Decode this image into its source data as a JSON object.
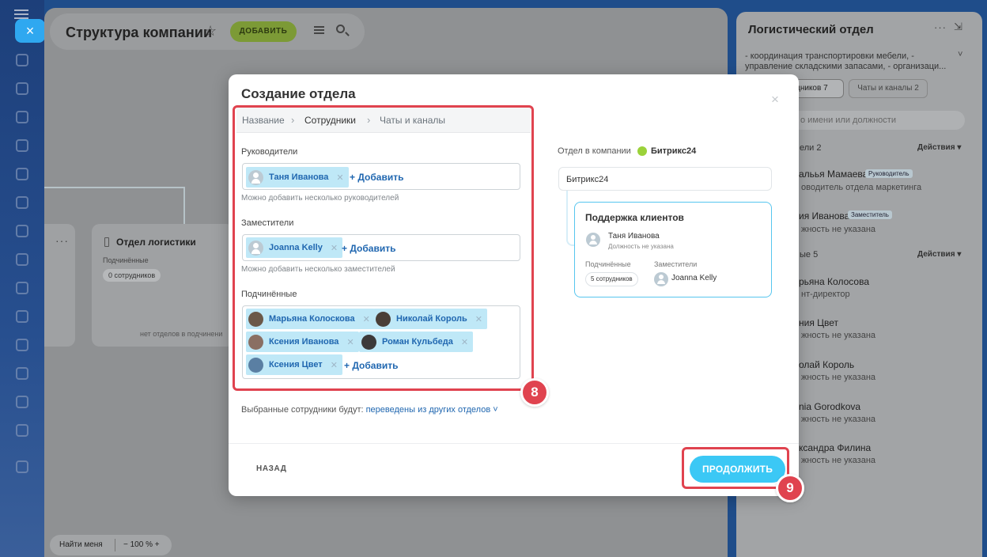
{
  "page": {
    "title": "Структура компании",
    "add_label": "ДОБАВИТЬ",
    "find_me": "Найти меня",
    "zoom_text": "−  100 %  +"
  },
  "org_card": {
    "title": "Отдел логистики",
    "subordinates_label": "Подчинённые",
    "count_badge": "0 сотрудников",
    "no_departments": "нет отделов в подчинени"
  },
  "right_panel": {
    "title": "Логистический отдел",
    "description": "- координация транспортировки мебели, - управление складскими запасами, - организаци...",
    "tab_employees": "дников 7",
    "tab_chats": "Чаты и каналы 2",
    "search_placeholder": "о имени или должности",
    "section_heads": "ели 2",
    "section_employees": "ые 5",
    "actions_label": "Действия ▾",
    "people": [
      {
        "name": "альья Мамаева",
        "badge": "Руководитель",
        "position": "оводитель отдела маркетинга"
      },
      {
        "name": "ия Иванова",
        "badge": "Заместитель",
        "position": "жность не указана"
      },
      {
        "name": "рьяна Колосова",
        "position": "нт-директор"
      },
      {
        "name": "ния Цвет",
        "position": "жность не указана"
      },
      {
        "name": "олай Король",
        "position": "жность не указана"
      },
      {
        "name": "nia Gorodkova",
        "position": "жность не указана"
      },
      {
        "name": "ксандра Филина",
        "position": "жность не указана"
      }
    ]
  },
  "modal": {
    "title": "Создание отдела",
    "close": "×",
    "breadcrumbs": [
      "Название",
      "Сотрудники",
      "Чаты и каналы"
    ],
    "heads_label": "Руководители",
    "heads": [
      "Таня Иванова"
    ],
    "heads_hint": "Можно добавить несколько руководителей",
    "deputies_label": "Заместители",
    "deputies": [
      "Joanna Kelly"
    ],
    "deputies_hint": "Можно добавить несколько заместителей",
    "employees_label": "Подчинённые",
    "employees": [
      "Марьяна Колоскова",
      "Николай Король",
      "Ксения Иванова",
      "Роман Кульбеда",
      "Ксения Цвет"
    ],
    "add_link": "+ Добавить",
    "moved_prefix": "Выбранные сотрудники будут: ",
    "moved_link": "переведены из других отделов ˅",
    "back": "НАЗАД",
    "continue": "ПРОДОЛЖИТЬ",
    "step_employees": "8",
    "step_continue": "9"
  },
  "preview": {
    "label": "Отдел в компании",
    "company": "Битрикс24",
    "root": "Битрикс24",
    "dept_title": "Поддержка клиентов",
    "head_name": "Таня Иванова",
    "head_position": "Должность не указана",
    "subordinates_label": "Подчинённые",
    "deputies_label": "Заместители",
    "count": "5 сотрудников",
    "deputy_name": "Joanna Kelly"
  },
  "colors": {
    "accent": "#3bc8f5",
    "chip": "#bfe8f7",
    "link": "#2067b0",
    "highlight": "#e0434f"
  }
}
